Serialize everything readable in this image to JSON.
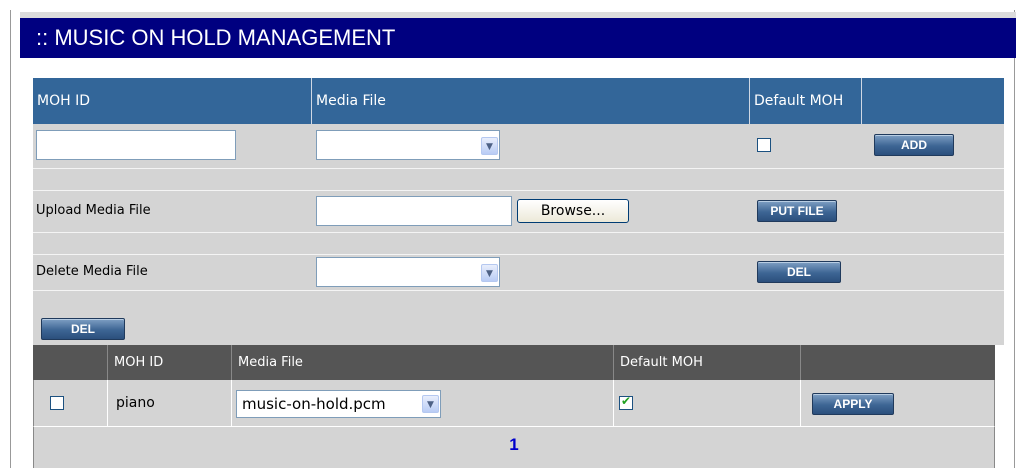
{
  "title": ":: MUSIC ON HOLD MANAGEMENT",
  "add_form": {
    "headers": {
      "moh_id": "MOH ID",
      "media_file": "Media File",
      "default_moh": "Default MOH"
    },
    "moh_id_value": "",
    "media_file_value": "",
    "default_checked": false,
    "add_button": "ADD"
  },
  "upload": {
    "label": "Upload Media File",
    "file_value": "",
    "browse_button": "Browse...",
    "put_button": "PUT FILE"
  },
  "delete": {
    "label": "Delete Media File",
    "file_value": "",
    "del_button": "DEL"
  },
  "list": {
    "del_button": "DEL",
    "columns": [
      "MOH ID",
      "Media File",
      "Default MOH"
    ],
    "rows": [
      {
        "checked": false,
        "moh_id": "piano",
        "media_file": "music-on-hold.pcm",
        "default": true,
        "apply_button": "APPLY"
      }
    ],
    "page": "1"
  }
}
